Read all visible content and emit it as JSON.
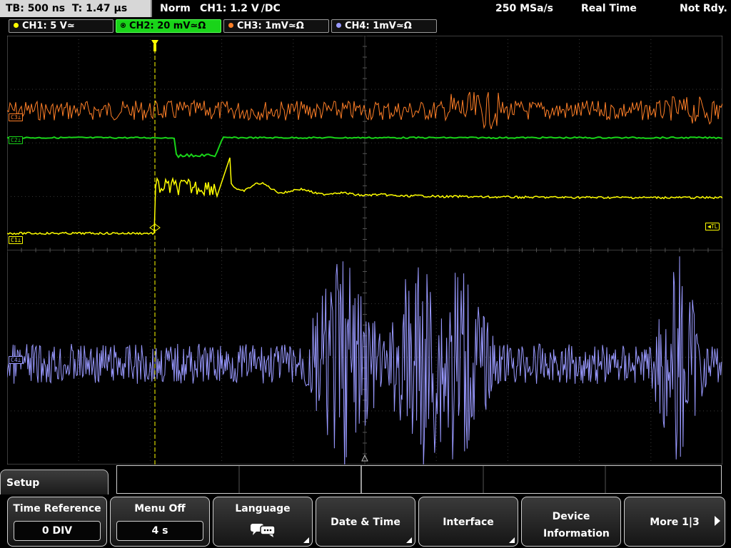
{
  "header": {
    "timebase": "TB: 500 ns",
    "trigger_time": "T: 1.47 µs",
    "trigger_mode": "Norm",
    "trigger_source": "CH1: 1.2 V",
    "trigger_edge": "∕DC",
    "sample_rate": "250 MSa/s",
    "acq_mode": "Real Time",
    "status": "Not Rdy."
  },
  "channels": [
    {
      "label": "CH1: 5 V≃",
      "color": "#ffff00",
      "active": false
    },
    {
      "label": "CH2: 20 mV≃Ω",
      "color": "#19d419",
      "active": true
    },
    {
      "label": "CH3: 1mV≃Ω",
      "color": "#ff7f27",
      "active": false
    },
    {
      "label": "CH4: 1mV≃Ω",
      "color": "#9999ff",
      "active": false
    }
  ],
  "markers": {
    "c3": "C3",
    "c2": "C2",
    "c1": "C1",
    "c4": "C4",
    "trigger_level": "TL",
    "trigger_pos": "T"
  },
  "menu": {
    "title": "Setup",
    "softkeys": [
      {
        "label": "Time Reference",
        "value": "0 DIV"
      },
      {
        "label": "Menu Off",
        "value": "4 s"
      },
      {
        "label": "Language",
        "icon": "speech-bubbles-icon"
      },
      {
        "label": "Date & Time"
      },
      {
        "label": "Interface"
      },
      {
        "label": "Device Information"
      },
      {
        "label": "More 1|3"
      }
    ]
  },
  "colors": {
    "ch1": "#ffff00",
    "ch2": "#19d419",
    "ch3": "#ff7f27",
    "ch4": "#9999ff",
    "grid": "#3a3a3a"
  }
}
